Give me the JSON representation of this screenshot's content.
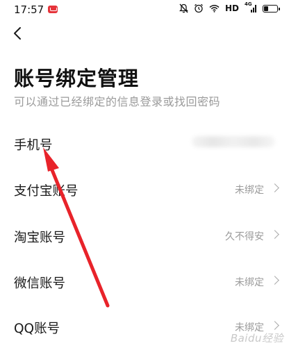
{
  "status_bar": {
    "time": "17:57",
    "network": "HD",
    "signal": "4G"
  },
  "page": {
    "title": "账号绑定管理",
    "subtitle": "可以通过已经绑定的信息登录或找回密码"
  },
  "rows": [
    {
      "label": "手机号",
      "value": ""
    },
    {
      "label": "支付宝账号",
      "value": "未绑定"
    },
    {
      "label": "淘宝账号",
      "value": "久不得安"
    },
    {
      "label": "微信账号",
      "value": "未绑定"
    },
    {
      "label": "QQ账号",
      "value": "未绑定"
    }
  ],
  "watermark": "Baidu经验",
  "colors": {
    "annotation_arrow": "#e8232a",
    "secondary_text": "#9a9a9a"
  }
}
